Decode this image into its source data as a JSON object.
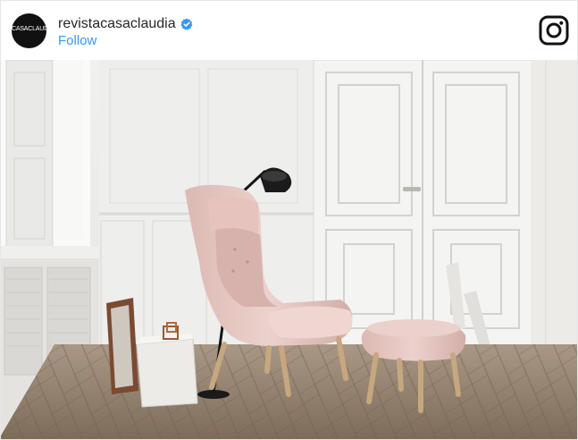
{
  "post": {
    "username": "revistacasaclaudia",
    "follow_label": "Follow",
    "avatar_text": "CASACLAUDIA",
    "verified_icon": "verified-badge-icon",
    "brand_icon": "instagram-icon",
    "colors": {
      "follow": "#3897f0",
      "verified": "#3897f0",
      "username": "#262626",
      "chair": "#e8c9c4"
    }
  }
}
